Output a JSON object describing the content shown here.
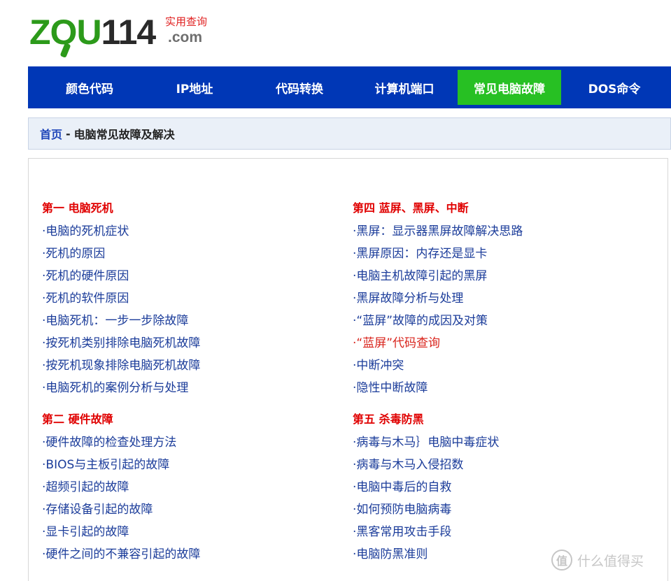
{
  "logo": {
    "word_green_1": "ZO",
    "word_green_2": "U",
    "word_dark": "114",
    "tagline": "实用查询",
    "domain": ".com"
  },
  "nav": {
    "items": [
      {
        "label": "颜色代码",
        "active": false
      },
      {
        "label": "IP地址",
        "active": false
      },
      {
        "label": "代码转换",
        "active": false
      },
      {
        "label": "计算机端口",
        "active": false
      },
      {
        "label": "常见电脑故障",
        "active": true
      },
      {
        "label": "DOS命令",
        "active": false
      }
    ]
  },
  "breadcrumb": {
    "home": "首页",
    "separator": "-",
    "current": "电脑常见故障及解决"
  },
  "columns": {
    "left": [
      {
        "title": "第一 电脑死机",
        "links": [
          "·电脑的死机症状",
          "·死机的原因",
          "·死机的硬件原因",
          "·死机的软件原因",
          "·电脑死机：一步一步除故障",
          "·按死机类别排除电脑死机故障",
          "·按死机现象排除电脑死机故障",
          "·电脑死机的案例分析与处理"
        ]
      },
      {
        "title": "第二 硬件故障",
        "links": [
          "·硬件故障的检查处理方法",
          "·BIOS与主板引起的故障",
          "·超频引起的故障",
          "·存储设备引起的故障",
          "·显卡引起的故障",
          "·硬件之间的不兼容引起的故障"
        ]
      }
    ],
    "right": [
      {
        "title": "第四 蓝屏、黑屏、中断",
        "links": [
          "·黑屏：显示器黑屏故障解决思路",
          "·黑屏原因：内存还是显卡",
          "·电脑主机故障引起的黑屏",
          "·黑屏故障分析与处理",
          "·“蓝屏”故障的成因及对策",
          "·“蓝屏”代码查询",
          "·中断冲突",
          "·隐性中断故障"
        ],
        "highlight_index": 5
      },
      {
        "title": "第五 杀毒防黑",
        "links": [
          "·病毒与木马｝电脑中毒症状",
          "·病毒与木马入侵招数",
          "·电脑中毒后的自救",
          "·如何预防电脑病毒",
          "·黑客常用攻击手段",
          "·电脑防黑准则"
        ]
      }
    ]
  },
  "watermark": {
    "badge": "值",
    "text": "什么值得买"
  },
  "colors": {
    "nav_bg": "#0037b6",
    "nav_active": "#27c023",
    "section_title": "#e00000",
    "link": "#1b3c9a",
    "link_highlight": "#d9251d"
  }
}
